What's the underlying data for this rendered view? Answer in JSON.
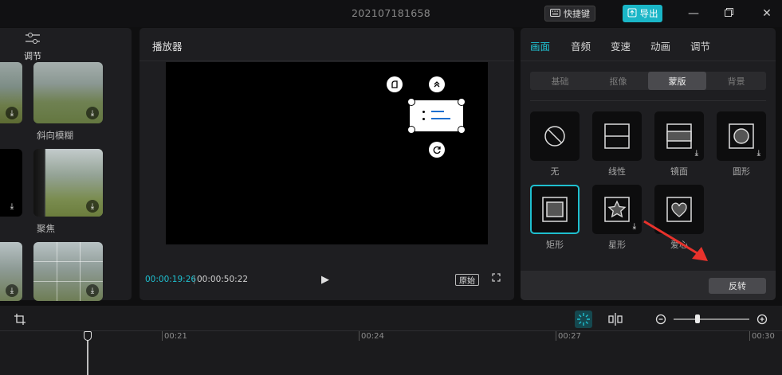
{
  "titlebar": {
    "doc_title": "202107181658",
    "shortcut_label": "快捷键",
    "export_label": "导出"
  },
  "left_panel": {
    "adjust_label": "调节",
    "items": [
      {
        "label": "斜向模糊"
      },
      {
        "label": "聚焦"
      }
    ]
  },
  "player": {
    "title": "播放器",
    "current_time": "00:00:19:26",
    "total_time": "00:00:50:22",
    "original_label": "原始"
  },
  "right_panel": {
    "tabs": [
      "画面",
      "音频",
      "变速",
      "动画",
      "调节"
    ],
    "active_tab": "画面",
    "subtabs": [
      "基础",
      "抠像",
      "蒙版",
      "背景"
    ],
    "active_subtab": "蒙版",
    "masks": [
      {
        "label": "无",
        "icon": "none-icon"
      },
      {
        "label": "线性",
        "icon": "linear-mask-icon"
      },
      {
        "label": "镜面",
        "icon": "mirror-mask-icon"
      },
      {
        "label": "圆形",
        "icon": "circle-mask-icon"
      },
      {
        "label": "矩形",
        "icon": "rectangle-mask-icon"
      },
      {
        "label": "星形",
        "icon": "star-mask-icon"
      },
      {
        "label": "爱心",
        "icon": "heart-mask-icon"
      }
    ],
    "selected_mask": "矩形",
    "invert_label": "反转"
  },
  "timeline": {
    "ruler": [
      "00:21",
      "00:24",
      "00:27",
      "00:30"
    ]
  },
  "colors": {
    "accent": "#1fc0d0",
    "annotation_arrow": "#e8322c"
  }
}
